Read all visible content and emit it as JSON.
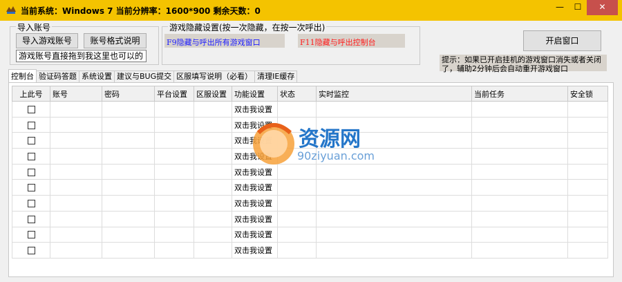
{
  "window": {
    "title": "当前系统：Windows 7   当前分辨率：1600*900    剩余天数：0",
    "minimize_glyph": "—",
    "maximize_glyph": "☐",
    "close_glyph": "✕"
  },
  "import": {
    "group_label": "导入账号",
    "import_button": "导入游戏账号",
    "format_button": "账号格式说明",
    "drop_hint": "游戏账号直接拖到我这里也可以的"
  },
  "hide_settings": {
    "group_label": "游戏隐藏设置(按一次隐藏，在按一次呼出)",
    "f9_label": "F9隐藏与呼出所有游戏窗口",
    "f11_label": "F11隐藏与呼出控制台",
    "f9_color": "#1a1aff",
    "f11_color": "#ff1a1a"
  },
  "open_window_button": "开启窗口",
  "tip": "提示：如果已开启挂机的游戏窗口消失或者关闭了，辅助2分钟后会自动重开游戏窗口",
  "tabs": [
    "控制台",
    "验证码答题",
    "系统设置",
    "建议与BUG提交",
    "区服填写说明（必看）",
    "清理IE缓存"
  ],
  "table": {
    "columns": [
      "上此号",
      "账号",
      "密码",
      "平台设置",
      "区服设置",
      "功能设置",
      "状态",
      "实时监控",
      "当前任务",
      "安全锁"
    ],
    "rows": [
      {
        "function": "双击我设置"
      },
      {
        "function": "双击我设置"
      },
      {
        "function": "双击我设置"
      },
      {
        "function": "双击我设置"
      },
      {
        "function": "双击我设置"
      },
      {
        "function": "双击我设置"
      },
      {
        "function": "双击我设置"
      },
      {
        "function": "双击我设置"
      },
      {
        "function": "双击我设置"
      },
      {
        "function": "双击我设置"
      }
    ]
  },
  "watermark": {
    "name": "资源网",
    "url": "90ziyuan.com",
    "icon": "90-logo-icon"
  }
}
